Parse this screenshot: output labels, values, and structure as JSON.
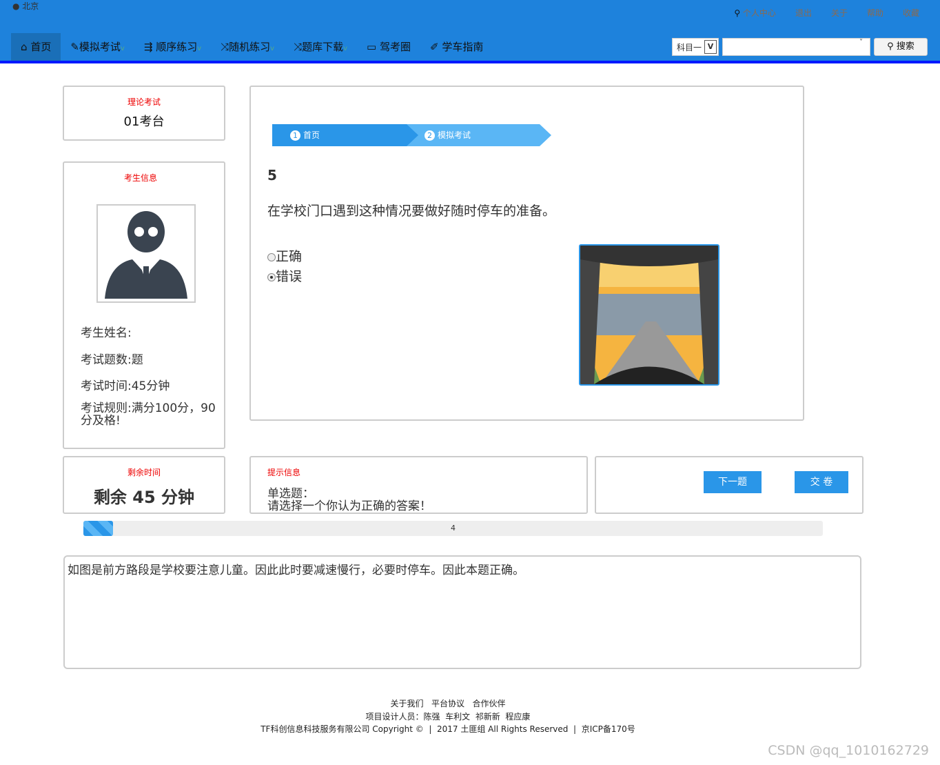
{
  "header": {
    "location": "北京",
    "links": [
      "个人中心",
      "退出",
      "关于",
      "帮助",
      "收藏"
    ],
    "nav": [
      {
        "label": "首页",
        "icon": "home-icon"
      },
      {
        "label": "模拟考试",
        "icon": "pencil-icon",
        "dropdown": true
      },
      {
        "label": "顺序练习",
        "icon": "sort-icon",
        "dropdown": true
      },
      {
        "label": "随机练习",
        "icon": "shuffle-icon",
        "dropdown": true
      },
      {
        "label": "题库下载",
        "icon": "shuffle-icon",
        "dropdown": true
      },
      {
        "label": "驾考圈",
        "icon": "chat-icon"
      },
      {
        "label": "学车指南",
        "icon": "leaf-icon"
      }
    ],
    "subject_select": "科目一",
    "search_value": "",
    "search_label": "搜索"
  },
  "exam": {
    "type_label": "理论考试",
    "seat": "01考台"
  },
  "student": {
    "title": "考生信息",
    "name_label": "考生姓名:",
    "count_label": "考试题数:题",
    "time_label": "考试时间:45分钟",
    "rule_label": "考试规则:满分100分，90分及格!"
  },
  "steps": [
    {
      "num": "1",
      "label": "首页"
    },
    {
      "num": "2",
      "label": "模拟考试"
    }
  ],
  "question": {
    "number": "5",
    "text": "在学校门口遇到这种情况要做好随时停车的准备。",
    "options": [
      {
        "label": "正确",
        "selected": false
      },
      {
        "label": "错误",
        "selected": true
      }
    ]
  },
  "timer": {
    "title": "剩余时间",
    "text": "剩余 45 分钟"
  },
  "hint": {
    "title": "提示信息",
    "line1": "单选题：",
    "line2": "请选择一个你认为正确的答案！"
  },
  "buttons": {
    "next": "下一题",
    "submit": "交 卷"
  },
  "progress": {
    "value": 4,
    "percent": 4
  },
  "explanation": "如图是前方路段是学校要注意儿童。因此此时要减速慢行，必要时停车。因此本题正确。",
  "footer": {
    "links": [
      "关于我们",
      "平台协议",
      "合作伙伴"
    ],
    "designers": "项目设计人员：陈强  车利文  祁新新  程应康",
    "copyright": "TF科创信息科技服务有限公司 Copyright ©  |  2017 土匪组 All Rights Reserved  |  京ICP备170号"
  },
  "watermark": "CSDN @qq_1010162729"
}
